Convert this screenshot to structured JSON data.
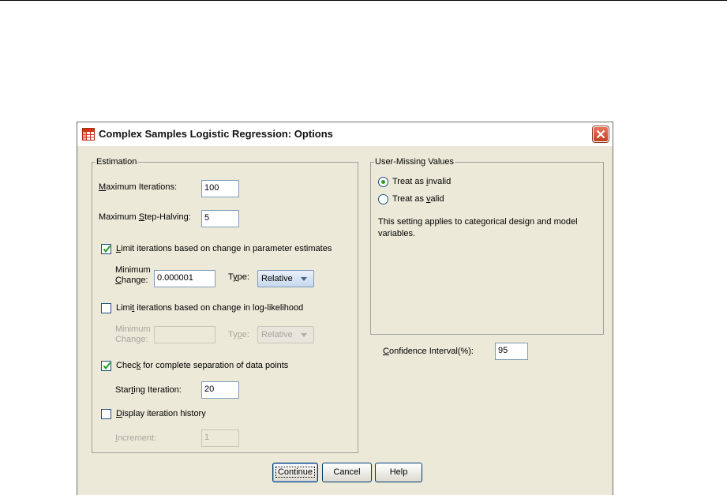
{
  "dialog": {
    "title": "Complex Samples Logistic Regression: Options",
    "icon": "spss-grid-icon",
    "close_icon": "close-icon"
  },
  "estimation": {
    "legend": "Estimation",
    "max_iterations": {
      "label_u": "M",
      "label_rest": "aximum Iterations:",
      "value": "100"
    },
    "max_step_halving": {
      "label_pre": "Maximum ",
      "label_u": "S",
      "label_rest": "tep-Halving:",
      "value": "5"
    },
    "limit_param": {
      "label_u": "L",
      "label_rest": "imit iterations based on change in parameter estimates",
      "checked": true,
      "min_change_label_1": "Minimum",
      "min_change_label_2_u": "C",
      "min_change_label_2_rest": "hange:",
      "min_change_value": "0.000001",
      "type_label_pre": "T",
      "type_label_u": "y",
      "type_label_rest": "pe:",
      "type_value": "Relative"
    },
    "limit_loglik": {
      "label_pre": "Limi",
      "label_u": "t",
      "label_rest": " iterations based on change in log-likelihood",
      "checked": false,
      "min_change_label_1": "Minimum",
      "min_change_label_2_pre": "Chan",
      "min_change_label_2_u": "g",
      "min_change_label_2_rest": "e:",
      "min_change_value": "",
      "type_label_pre": "Ty",
      "type_label_u": "p",
      "type_label_rest": "e:",
      "type_value": "Relative"
    },
    "complete_sep": {
      "label_pre": "Chec",
      "label_u": "k",
      "label_rest": " for complete separation of data points",
      "checked": true,
      "start_label_pre": "Star",
      "start_label_u": "t",
      "start_label_rest": "ing Iteration:",
      "start_value": "20"
    },
    "iter_history": {
      "label_u": "D",
      "label_rest": "isplay iteration history",
      "checked": false,
      "increment_label_u": "I",
      "increment_label_rest": "ncrement:",
      "increment_value": "1"
    }
  },
  "user_missing": {
    "legend": "User-Missing Values",
    "invalid": {
      "label_pre": "Treat as ",
      "label_u": "i",
      "label_rest": "nvalid",
      "selected": true
    },
    "valid": {
      "label_pre": "Treat as ",
      "label_u": "v",
      "label_rest": "alid",
      "selected": false
    },
    "note": "This setting applies to categorical design and model variables."
  },
  "confidence": {
    "label_u": "C",
    "label_rest": "onfidence Interval(%):",
    "value": "95"
  },
  "buttons": {
    "continue": "Continue",
    "cancel": "Cancel",
    "help": "Help"
  }
}
